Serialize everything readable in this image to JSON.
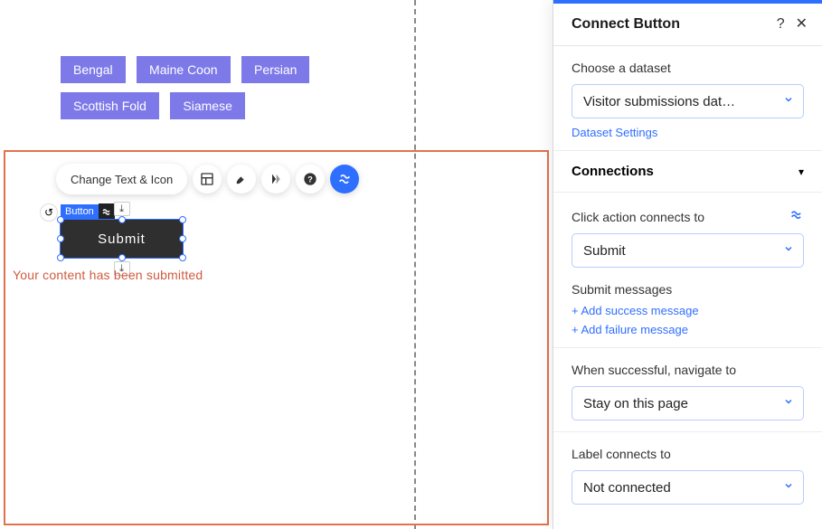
{
  "canvas": {
    "tags": [
      "Bengal",
      "Maine Coon",
      "Persian",
      "Scottish Fold",
      "Siamese"
    ],
    "toolbar": {
      "change_text_icon": "Change Text & Icon"
    },
    "element_badge": "Button",
    "submit_label": "Submit",
    "overlap_text": "Your content has been submitted"
  },
  "panel": {
    "title": "Connect Button",
    "dataset": {
      "label": "Choose a dataset",
      "value": "Visitor submissions dat…",
      "settings_link": "Dataset Settings"
    },
    "connections": {
      "heading": "Connections",
      "click_label": "Click action connects to",
      "click_value": "Submit",
      "submit_messages": {
        "heading": "Submit messages",
        "add_success": "+ Add success message",
        "add_failure": "+ Add failure message"
      },
      "navigate": {
        "label": "When successful, navigate to",
        "value": "Stay on this page"
      },
      "label_connects": {
        "label": "Label connects to",
        "value": "Not connected"
      }
    }
  }
}
